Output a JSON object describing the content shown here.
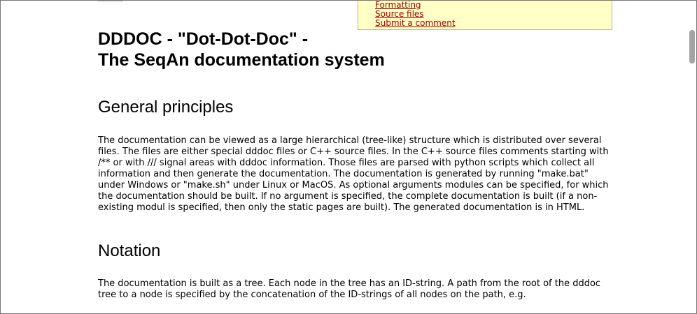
{
  "toc": {
    "links": [
      "Formatting",
      "Source files",
      "Submit a comment"
    ]
  },
  "page": {
    "title_line1": "DDDOC - \"Dot-Dot-Doc\" -",
    "title_line2": "The SeqAn documentation system"
  },
  "sections": [
    {
      "heading": "General principles",
      "body": "The documentation can be viewed as a large hierarchical (tree-like) structure which is distributed over several files. The files are either special dddoc files or C++ source files. In the C++ source files comments starting with /** or with /// signal areas with dddoc information. Those files are parsed with python scripts which collect all information and then generate the documentation. The documentation is generated by running \"make.bat\" under Windows or \"make.sh\" under Linux or MacOS. As optional arguments modules can be specified, for which the documentation should be built. If no argument is specified, the complete documentation is built (if a non-existing modul is specified, then only the static pages are built). The generated documentation is in HTML."
    },
    {
      "heading": "Notation",
      "body": "The documentation is built as a tree. Each node in the tree has an ID-string. A path from the root of the dddoc tree to a node is specified by the concatenation of the ID-strings of all nodes on the path, e.g."
    }
  ]
}
